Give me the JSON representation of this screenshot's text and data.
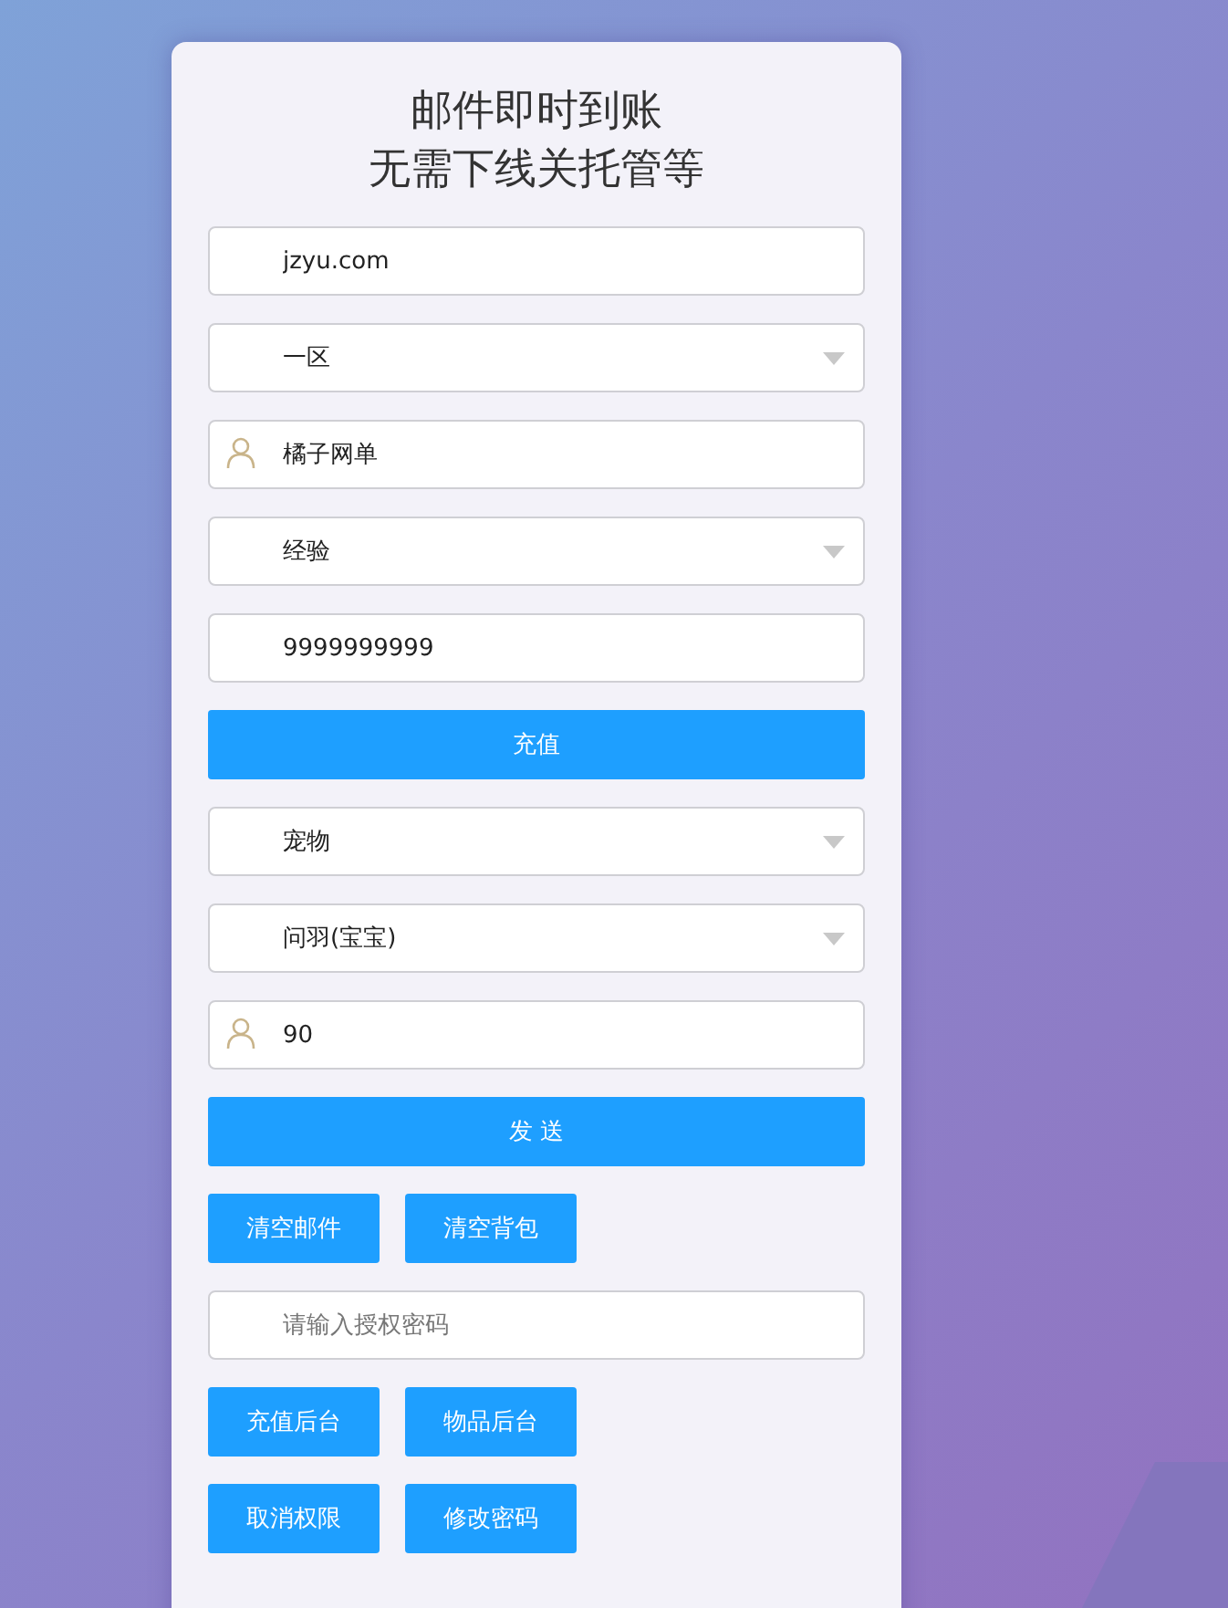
{
  "title": [
    "邮件即时到账",
    "无需下线关托管等"
  ],
  "rows": [
    {
      "kind": "input",
      "value": "jzyu.com",
      "user_icon": false
    },
    {
      "kind": "select",
      "value": "一区"
    },
    {
      "kind": "input",
      "value": "橘子网单",
      "user_icon": true
    },
    {
      "kind": "select",
      "value": "经验"
    },
    {
      "kind": "input",
      "value": "9999999999",
      "user_icon": false
    },
    {
      "kind": "button",
      "label": "充值"
    },
    {
      "kind": "select",
      "value": "宠物"
    },
    {
      "kind": "select",
      "value": "问羽(宝宝)"
    },
    {
      "kind": "input",
      "value": "90",
      "user_icon": true
    },
    {
      "kind": "button",
      "label": "发 送"
    },
    {
      "kind": "buttons",
      "labels": [
        "清空邮件",
        "清空背包"
      ]
    },
    {
      "kind": "input",
      "placeholder": "请输入授权密码",
      "user_icon": false
    },
    {
      "kind": "buttons",
      "labels": [
        "充值后台",
        "物品后台"
      ]
    },
    {
      "kind": "buttons",
      "labels": [
        "取消权限",
        "修改密码"
      ]
    }
  ]
}
